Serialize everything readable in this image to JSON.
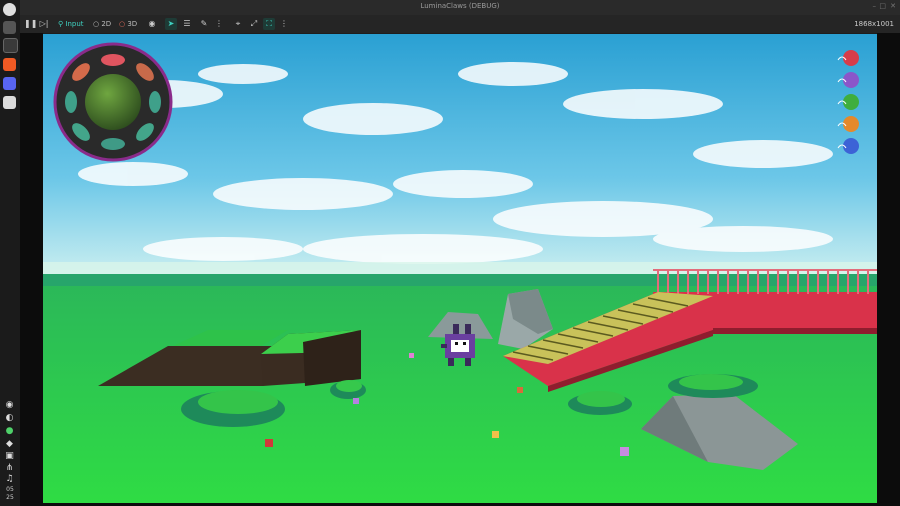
{
  "window": {
    "title": "LuminaClaws (DEBUG)",
    "controls": [
      "–",
      "□",
      "✕"
    ]
  },
  "toolbar": {
    "input_label": "Input",
    "mode_2d": "2D",
    "mode_3d": "3D",
    "resolution": "1868x1001"
  },
  "dock": {
    "icons": [
      "system-logo-icon",
      "files-icon",
      "terminal-icon",
      "brave-browser-icon",
      "discord-icon",
      "settings-icon",
      "discord-tray-icon",
      "steam-tray-icon",
      "whatsapp-tray-icon",
      "shield-tray-icon",
      "box-tray-icon",
      "network-tray-icon",
      "music-tray-icon"
    ],
    "clock_hour": "05",
    "clock_minute": "25"
  },
  "hud": {
    "fish_wheel_slots": 8,
    "yarn_balls": [
      {
        "color": "#d63c4a"
      },
      {
        "color": "#8b56c9"
      },
      {
        "color": "#3fae3d"
      },
      {
        "color": "#e5892b"
      },
      {
        "color": "#3c63d6"
      }
    ]
  },
  "colors": {
    "accent": "#3fd1c1",
    "sky_top": "#2fa6d6",
    "grass": "#2ed24a",
    "bridge": "#d9324a"
  }
}
